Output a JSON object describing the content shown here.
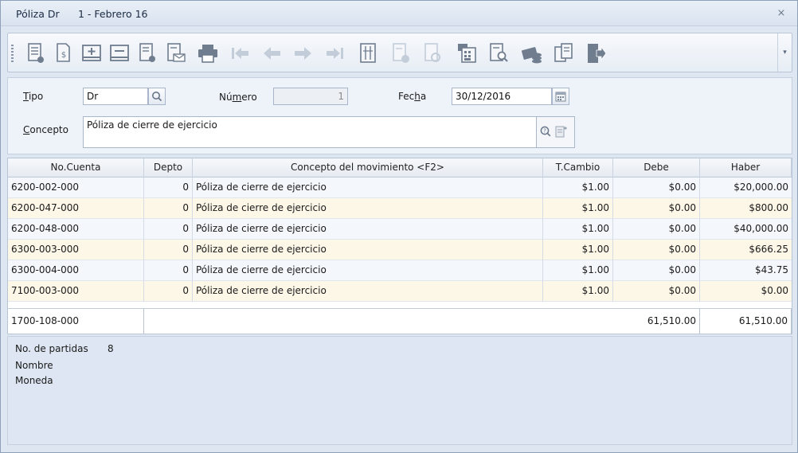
{
  "window": {
    "title": "Póliza Dr",
    "subtitle": "1 - Febrero 16",
    "close_glyph": "⨯"
  },
  "toolbar": {
    "buttons": [
      {
        "name": "document-view-icon",
        "enabled": true
      },
      {
        "name": "document-currency-icon",
        "enabled": true
      },
      {
        "name": "add-row-icon",
        "enabled": true
      },
      {
        "name": "remove-row-icon",
        "enabled": true
      },
      {
        "name": "document-settings-icon",
        "enabled": true
      },
      {
        "name": "document-mail-icon",
        "enabled": true
      },
      {
        "name": "printer-icon",
        "enabled": true
      },
      {
        "name": "first-record-icon",
        "enabled": false
      },
      {
        "name": "previous-record-icon",
        "enabled": false
      },
      {
        "name": "next-record-icon",
        "enabled": false
      },
      {
        "name": "last-record-icon",
        "enabled": false
      },
      {
        "name": "document-columns-icon",
        "enabled": true
      },
      {
        "name": "document-disabled-icon",
        "enabled": false
      },
      {
        "name": "document-refresh-icon",
        "enabled": false
      },
      {
        "name": "calculator-icon",
        "enabled": true
      },
      {
        "name": "document-search-icon",
        "enabled": true
      },
      {
        "name": "payment-card-icon",
        "enabled": true
      },
      {
        "name": "copy-document-icon",
        "enabled": true
      },
      {
        "name": "exit-door-icon",
        "enabled": true
      }
    ],
    "overflow_glyph": "▾"
  },
  "form": {
    "tipo_label_u": "T",
    "tipo_label_rest": "ipo",
    "tipo_value": "Dr",
    "numero_label_pre": "Nú",
    "numero_label_u": "m",
    "numero_label_post": "ero",
    "numero_value": "1",
    "fecha_label_pre": "Fec",
    "fecha_label_u": "h",
    "fecha_label_post": "a",
    "fecha_value": "30/12/2016",
    "concepto_label_u": "C",
    "concepto_label_rest": "oncepto",
    "concepto_value": "Póliza de cierre de ejercicio"
  },
  "grid": {
    "columns": {
      "cuenta": "No.Cuenta",
      "depto": "Depto",
      "concepto": "Concepto del movimiento <F2>",
      "tc": "T.Cambio",
      "debe": "Debe",
      "haber": "Haber"
    },
    "rows": [
      {
        "cuenta": "6200-002-000",
        "depto": "0",
        "concepto": "Póliza de cierre de ejercicio",
        "tc": "$1.00",
        "debe": "$0.00",
        "haber": "$20,000.00"
      },
      {
        "cuenta": "6200-047-000",
        "depto": "0",
        "concepto": "Póliza de cierre de ejercicio",
        "tc": "$1.00",
        "debe": "$0.00",
        "haber": "$800.00"
      },
      {
        "cuenta": "6200-048-000",
        "depto": "0",
        "concepto": "Póliza de cierre de ejercicio",
        "tc": "$1.00",
        "debe": "$0.00",
        "haber": "$40,000.00"
      },
      {
        "cuenta": "6300-003-000",
        "depto": "0",
        "concepto": "Póliza de cierre de ejercicio",
        "tc": "$1.00",
        "debe": "$0.00",
        "haber": "$666.25"
      },
      {
        "cuenta": "6300-004-000",
        "depto": "0",
        "concepto": "Póliza de cierre de ejercicio",
        "tc": "$1.00",
        "debe": "$0.00",
        "haber": "$43.75"
      },
      {
        "cuenta": "7100-003-000",
        "depto": "0",
        "concepto": "Póliza de cierre de ejercicio",
        "tc": "$1.00",
        "debe": "$0.00",
        "haber": "$0.00"
      }
    ],
    "totals": {
      "cuenta": "1700-108-000",
      "debe": "61,510.00",
      "haber": "61,510.00"
    }
  },
  "info": {
    "partidas_label": "No. de partidas",
    "partidas_value": "8",
    "nombre_label": "Nombre",
    "moneda_label": "Moneda"
  },
  "colors": {
    "row_odd": "#f4f7fb",
    "row_even": "#fdf7e8",
    "icon_gray": "#6f7d8f",
    "icon_disabled": "#c3cdd9"
  }
}
